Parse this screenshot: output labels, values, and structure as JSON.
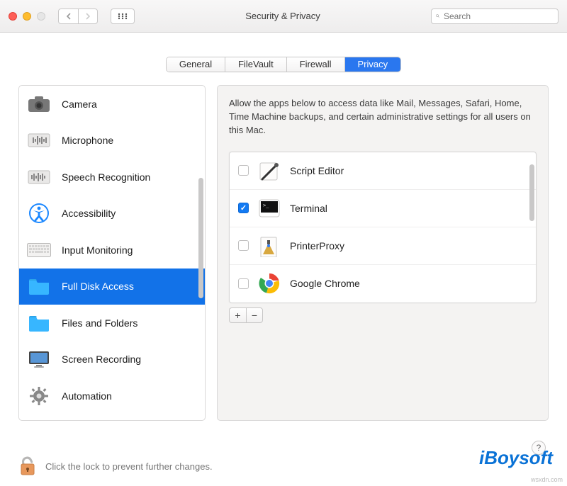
{
  "window": {
    "title": "Security & Privacy",
    "search_placeholder": "Search"
  },
  "tabs": {
    "items": [
      {
        "label": "General",
        "active": false
      },
      {
        "label": "FileVault",
        "active": false
      },
      {
        "label": "Firewall",
        "active": false
      },
      {
        "label": "Privacy",
        "active": true
      }
    ]
  },
  "sidebar": {
    "items": [
      {
        "label": "Camera",
        "icon": "camera-icon",
        "selected": false
      },
      {
        "label": "Microphone",
        "icon": "microphone-icon",
        "selected": false
      },
      {
        "label": "Speech Recognition",
        "icon": "speech-icon",
        "selected": false
      },
      {
        "label": "Accessibility",
        "icon": "accessibility-icon",
        "selected": false
      },
      {
        "label": "Input Monitoring",
        "icon": "keyboard-icon",
        "selected": false
      },
      {
        "label": "Full Disk Access",
        "icon": "folder-icon",
        "selected": true
      },
      {
        "label": "Files and Folders",
        "icon": "folder-icon",
        "selected": false
      },
      {
        "label": "Screen Recording",
        "icon": "screen-icon",
        "selected": false
      },
      {
        "label": "Automation",
        "icon": "gear-icon",
        "selected": false
      }
    ]
  },
  "detail": {
    "description": "Allow the apps below to access data like Mail, Messages, Safari, Home, Time Machine backups, and certain administrative settings for all users on this Mac.",
    "apps": [
      {
        "name": "Script Editor",
        "checked": false,
        "icon": "script-editor-icon"
      },
      {
        "name": "Terminal",
        "checked": true,
        "icon": "terminal-icon"
      },
      {
        "name": "PrinterProxy",
        "checked": false,
        "icon": "printer-proxy-icon"
      },
      {
        "name": "Google Chrome",
        "checked": false,
        "icon": "chrome-icon"
      }
    ],
    "add_label": "+",
    "remove_label": "−"
  },
  "footer": {
    "lock_text": "Click the lock to prevent further changes."
  },
  "watermark": {
    "brand": "iBoysoft",
    "source": "wsxdn.com"
  }
}
